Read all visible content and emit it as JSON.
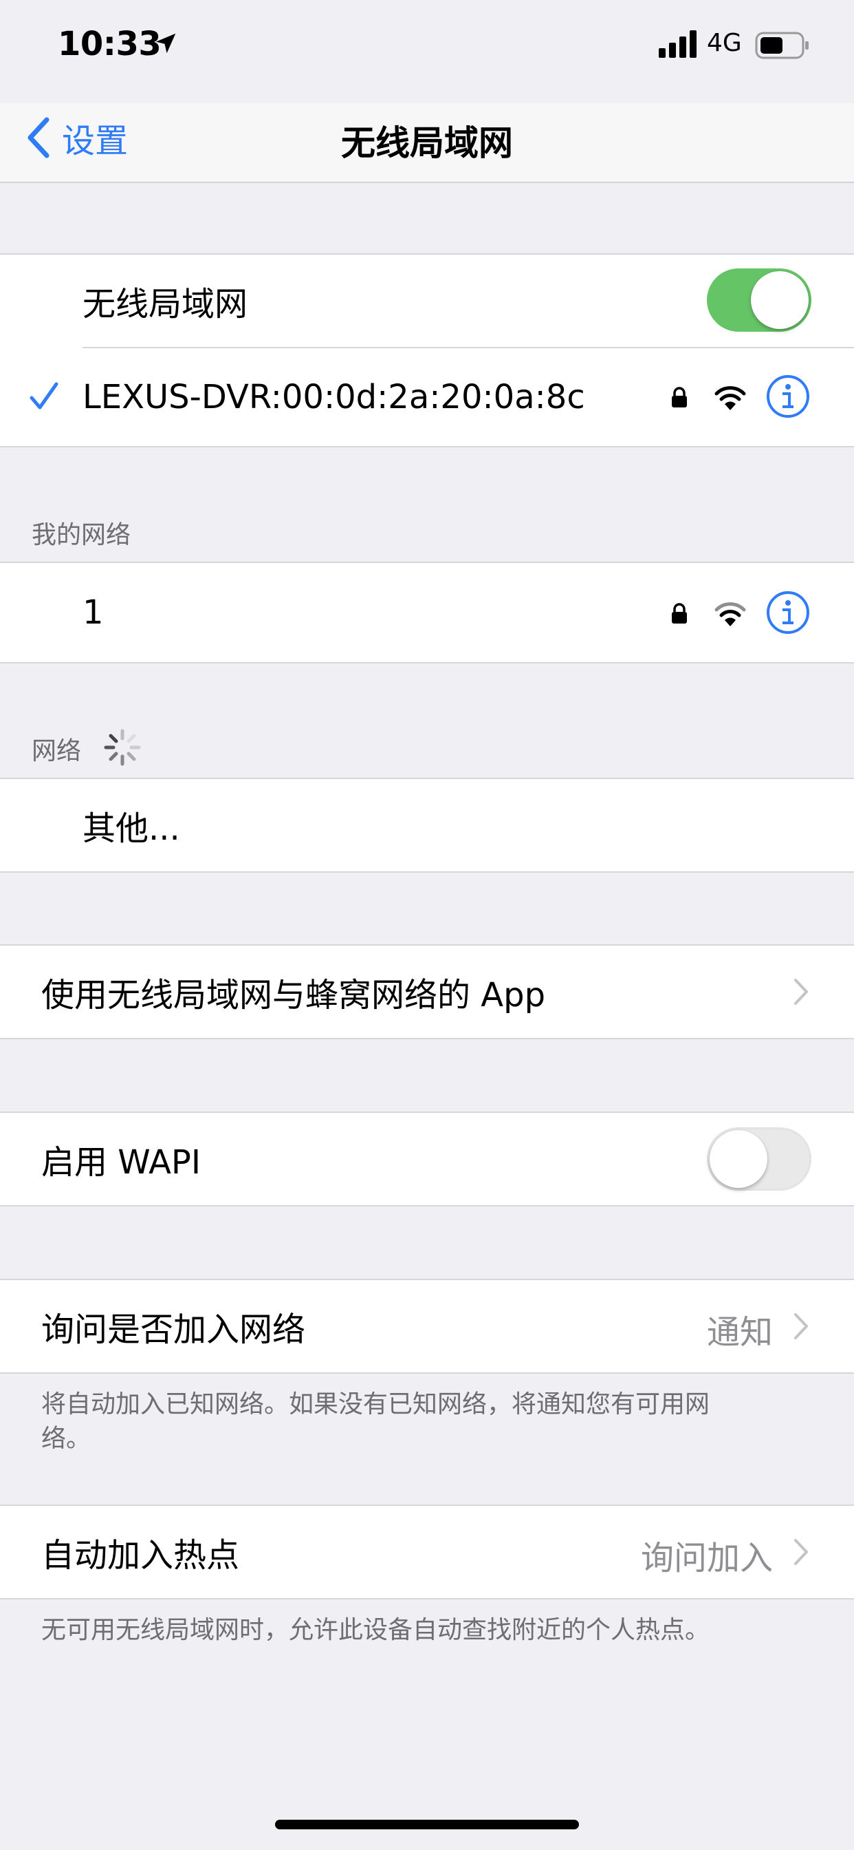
{
  "status_bar": {
    "time": "10:33",
    "network": "4G"
  },
  "nav": {
    "back_label": "设置",
    "title": "无线局域网"
  },
  "wifi": {
    "toggle_label": "无线局域网",
    "toggle_on": true,
    "connected_network": "LEXUS-DVR:00:0d:2a:20:0a:8c"
  },
  "my_networks": {
    "header": "我的网络",
    "items": [
      {
        "name": "1"
      }
    ]
  },
  "networks": {
    "header": "网络",
    "other_label": "其他..."
  },
  "apps_row": {
    "label": "使用无线局域网与蜂窝网络的 App"
  },
  "wapi": {
    "label": "启用 WAPI",
    "toggle_on": false
  },
  "ask_join": {
    "label": "询问是否加入网络",
    "value": "通知",
    "footer": "将自动加入已知网络。如果没有已知网络，将通知您有可用网络。"
  },
  "auto_hotspot": {
    "label": "自动加入热点",
    "value": "询问加入",
    "footer": "无可用无线局域网时，允许此设备自动查找附近的个人热点。"
  },
  "colors": {
    "accent": "#2f7cf6",
    "toggle_on": "#65c466",
    "background": "#efeff4"
  }
}
